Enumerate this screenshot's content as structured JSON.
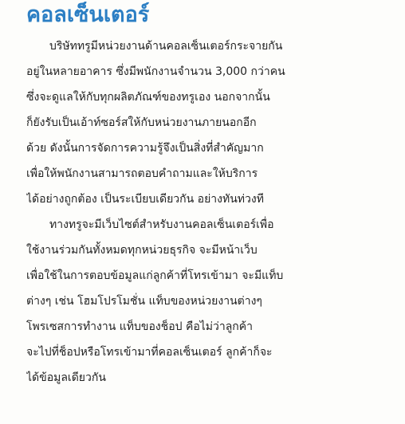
{
  "heading": "คอลเซ็นเตอร์",
  "paragraph_1": [
    "บริษัททรูมีหน่วยงานด้านคอลเซ็นเตอร์กระจายกัน",
    "อยู่ในหลายอาคาร ซึ่งมีพนักงานจำนวน 3,000 กว่าคน",
    "ซึ่งจะดูแลให้กับทุกผลิตภัณฑ์ของทรูเอง นอกจากนั้น",
    "ก็ยังรับเป็นเอ้าท์ซอร์สให้กับหน่วยงานภายนอกอีก",
    "ด้วย ดังนั้นการจัดการความรู้จึงเป็นสิ่งที่สำคัญมาก",
    "เพื่อให้พนักงานสามารถตอบคำถามและให้บริการ",
    "ได้อย่างถูกต้อง เป็นระเบียบเดียวกัน อย่างทันท่วงที"
  ],
  "paragraph_2": [
    "ทางทรูจะมีเว็บไซต์สำหรับงานคอลเซ็นเตอร์เพื่อ",
    "ใช้งานร่วมกันทั้งหมดทุกหน่วยธุรกิจ จะมีหน้าเว็บ",
    "เพื่อใช้ในการตอบข้อมูลแก่ลูกค้าที่โทรเข้ามา จะมีแท็บ",
    "ต่างๆ เช่น โฮมโปรโมชั่น แท็บของหน่วยงานต่างๆ",
    "โพรเซสการทำงาน แท็บของช็อป คือไม่ว่าลูกค้า",
    "จะไปที่ช็อปหรือโทรเข้ามาที่คอลเซ็นเตอร์ ลูกค้าก็จะ",
    "ได้ข้อมูลเดียวกัน"
  ],
  "colors": {
    "heading": "#2c7fc4",
    "text": "#222222",
    "paper": "#fdfdfb"
  }
}
